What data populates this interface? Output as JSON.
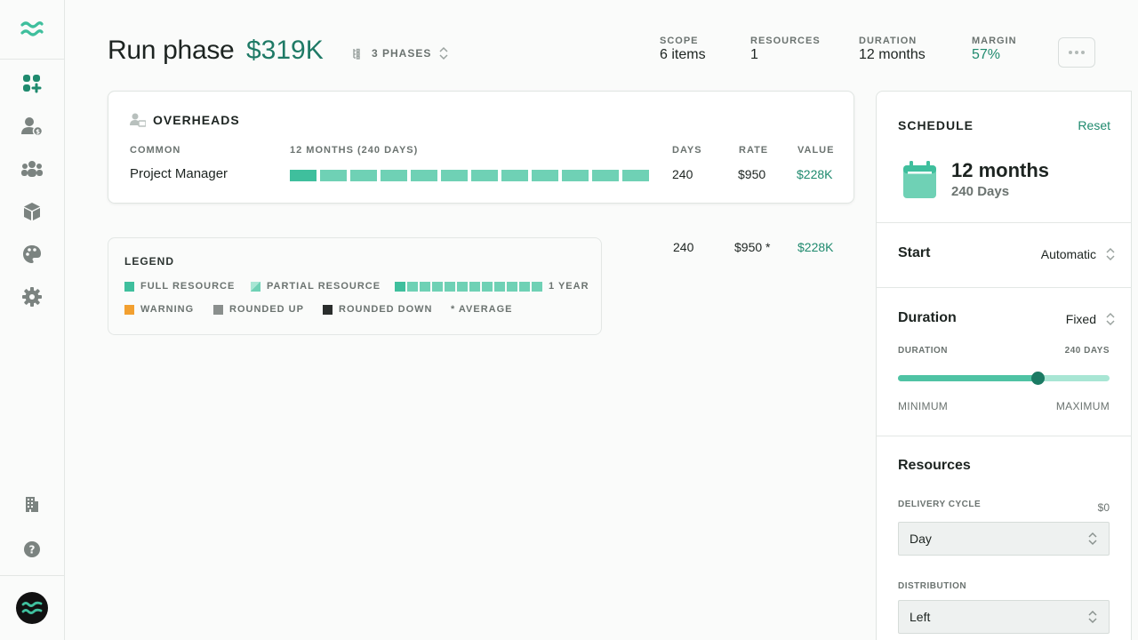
{
  "colors": {
    "accent": "#1f8a6e",
    "bar": "#6fd1b5",
    "bar_strong": "#3fbf9d",
    "warning": "#f2a030"
  },
  "sidebar": {
    "icons": [
      "logo-waves-icon",
      "dashboard-icon",
      "user-billing-icon",
      "team-icon",
      "box-icon",
      "palette-icon",
      "settings-icon",
      "building-icon",
      "help-icon",
      "avatar-icon"
    ]
  },
  "header": {
    "title": "Run phase",
    "amount": "$319K",
    "phases_label": "3 PHASES",
    "stats": [
      {
        "label": "SCOPE",
        "value": "6 items"
      },
      {
        "label": "RESOURCES",
        "value": "1"
      },
      {
        "label": "DURATION",
        "value": "12 months"
      },
      {
        "label": "MARGIN",
        "value": "57%"
      }
    ]
  },
  "overheads": {
    "title": "OVERHEADS",
    "columns": {
      "common": "COMMON",
      "timeline": "12 MONTHS (240 DAYS)",
      "days": "DAYS",
      "rate": "RATE",
      "value": "VALUE"
    },
    "row": {
      "name": "Project Manager",
      "months": 12,
      "days": "240",
      "rate": "$950",
      "value": "$228K"
    }
  },
  "totals": {
    "days": "240",
    "rate": "$950 *",
    "value": "$228K"
  },
  "legend": {
    "title": "LEGEND",
    "full": "FULL RESOURCE",
    "partial": "PARTIAL RESOURCE",
    "year": "1 YEAR",
    "warning": "WARNING",
    "rounded_up": "ROUNDED UP",
    "rounded_down": "ROUNDED DOWN",
    "average": "* AVERAGE"
  },
  "schedule": {
    "title": "SCHEDULE",
    "reset": "Reset",
    "months": "12 months",
    "days": "240 Days",
    "start_label": "Start",
    "start_value": "Automatic",
    "duration_label": "Duration",
    "duration_value": "Fixed",
    "slider_label": "DURATION",
    "slider_value_label": "240 DAYS",
    "slider_fraction": 0.66,
    "min_label": "MINIMUM",
    "max_label": "MAXIMUM"
  },
  "resources": {
    "title": "Resources",
    "delivery_cycle_label": "DELIVERY CYCLE",
    "delivery_cycle_cost": "$0",
    "delivery_cycle_value": "Day",
    "distribution_label": "DISTRIBUTION",
    "distribution_value": "Left"
  }
}
